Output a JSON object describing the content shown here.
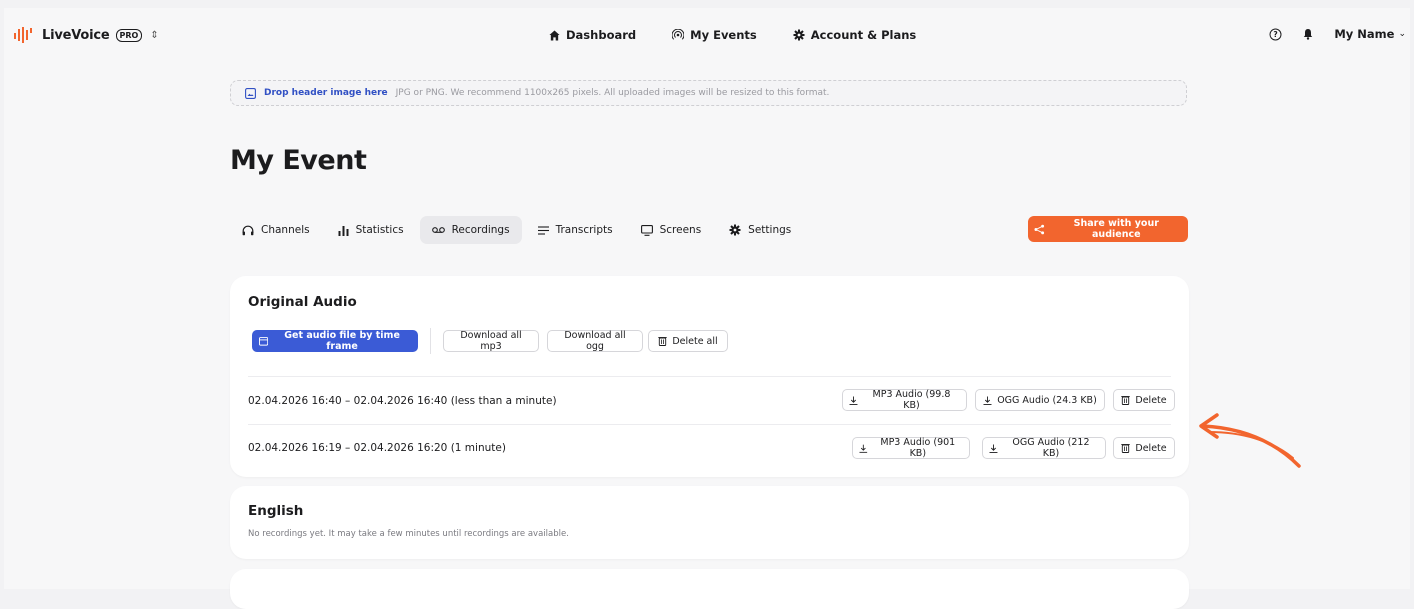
{
  "header": {
    "app_name": "LiveVoice",
    "plan_badge": "PRO",
    "nav": [
      {
        "label": "Dashboard",
        "icon": "home-icon"
      },
      {
        "label": "My Events",
        "icon": "broadcast-icon"
      },
      {
        "label": "Account & Plans",
        "icon": "gear-icon"
      }
    ],
    "user_name": "My Name",
    "icons": [
      "help-icon",
      "bell-icon"
    ]
  },
  "dropzone": {
    "title": "Drop header image here",
    "hint": "JPG or PNG. We recommend 1100x265 pixels. All uploaded images will be resized to this format."
  },
  "page_title": "My Event",
  "tabs": [
    {
      "label": "Channels",
      "icon": "headphones-icon",
      "active": false
    },
    {
      "label": "Statistics",
      "icon": "bar-chart-icon",
      "active": false
    },
    {
      "label": "Recordings",
      "icon": "voicemail-icon",
      "active": true
    },
    {
      "label": "Transcripts",
      "icon": "lines-icon",
      "active": false
    },
    {
      "label": "Screens",
      "icon": "monitor-icon",
      "active": false
    },
    {
      "label": "Settings",
      "icon": "gear-icon",
      "active": false
    }
  ],
  "share_button": "Share with your audience",
  "original_audio": {
    "title": "Original Audio",
    "get_by_time_frame": "Get audio file by time frame",
    "download_all_mp3": "Download all mp3",
    "download_all_ogg": "Download all ogg",
    "delete_all": "Delete all",
    "recordings": [
      {
        "range": "02.04.2026 16:40 – 02.04.2026 16:40 (less than a minute)",
        "mp3": "MP3 Audio (99.8 KB)",
        "ogg": "OGG Audio (24.3 KB)",
        "delete": "Delete"
      },
      {
        "range": "02.04.2026 16:19 – 02.04.2026 16:20 (1 minute)",
        "mp3": "MP3 Audio (901 KB)",
        "ogg": "OGG Audio (212 KB)",
        "delete": "Delete"
      }
    ]
  },
  "english": {
    "title": "English",
    "empty_message": "No recordings yet. It may take a few minutes until recordings are available."
  },
  "colors": {
    "accent_orange": "#f2652e",
    "primary_blue": "#3b5bd6",
    "link_blue": "#3150c4"
  }
}
